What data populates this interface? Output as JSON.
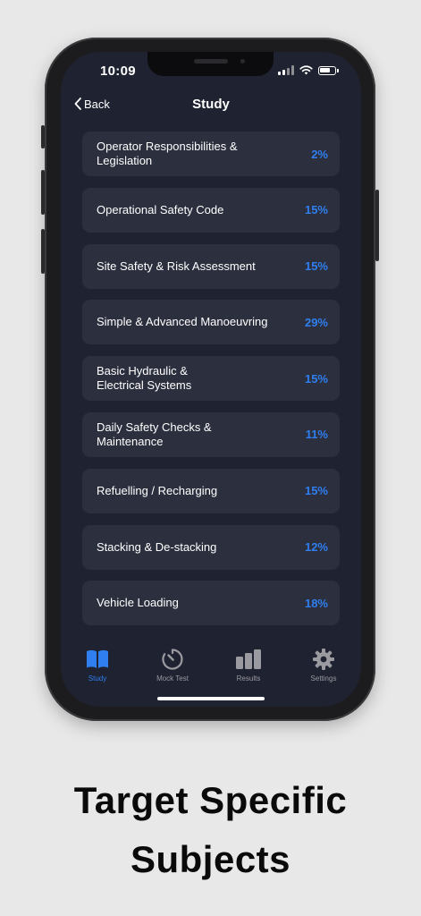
{
  "status_bar": {
    "time": "10:09"
  },
  "nav": {
    "back_label": "Back",
    "title": "Study"
  },
  "subjects": [
    {
      "label": "Operator Responsibilities &\nLegislation",
      "percent": "2%"
    },
    {
      "label": "Operational Safety Code",
      "percent": "15%"
    },
    {
      "label": "Site Safety & Risk Assessment",
      "percent": "15%"
    },
    {
      "label": "Simple & Advanced Manoeuvring",
      "percent": "29%"
    },
    {
      "label": "Basic Hydraulic &\nElectrical Systems",
      "percent": "15%"
    },
    {
      "label": "Daily Safety Checks &\nMaintenance",
      "percent": "11%"
    },
    {
      "label": "Refuelling / Recharging",
      "percent": "15%"
    },
    {
      "label": "Stacking & De-stacking",
      "percent": "12%"
    },
    {
      "label": "Vehicle Loading",
      "percent": "18%"
    }
  ],
  "tabs": [
    {
      "label": "Study",
      "icon": "book-icon",
      "active": true
    },
    {
      "label": "Mock Test",
      "icon": "stopwatch-icon",
      "active": false
    },
    {
      "label": "Results",
      "icon": "bar-chart-icon",
      "active": false
    },
    {
      "label": "Settings",
      "icon": "gear-icon",
      "active": false
    }
  ],
  "caption": {
    "line1": "Target Specific",
    "line2": "Subjects"
  },
  "colors": {
    "accent": "#2f7ff0",
    "screen_bg": "#1f2230",
    "card_bg": "#2c2f3e",
    "page_bg": "#e8e8e8"
  }
}
